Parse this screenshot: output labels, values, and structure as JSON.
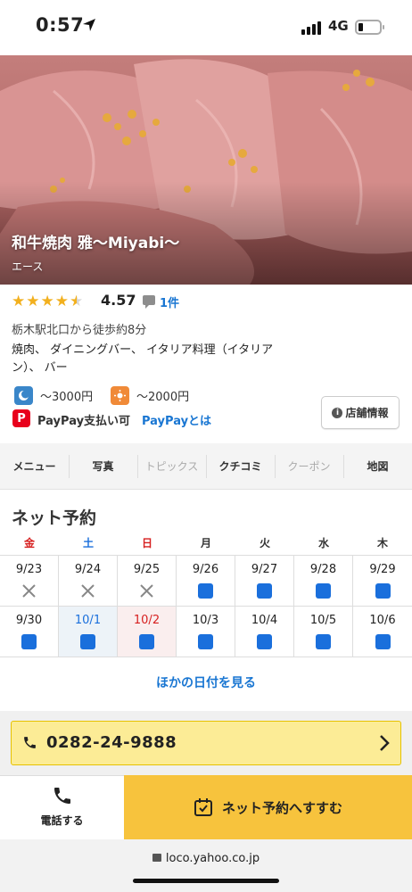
{
  "status_bar": {
    "time": "0:57",
    "network": "4G"
  },
  "hero": {
    "restaurant_name": "和牛焼肉 雅〜Miyabi〜",
    "area_label": "エース"
  },
  "rating": {
    "stars": 4.5,
    "score": "4.57",
    "review_count": "1件"
  },
  "access": "栃木駅北口から徒歩約8分",
  "genres": "焼肉、 ダイニングバー、 イタリア料理（イタリアン）、 バー",
  "prices": [
    {
      "icon": "moon-icon",
      "label": "〜3000円"
    },
    {
      "icon": "sun-icon",
      "label": "〜2000円"
    }
  ],
  "paypay": {
    "badge": "P",
    "available": "PayPay支払い可",
    "link": "PayPayとは"
  },
  "store_info_button": "店舗情報",
  "tabs": [
    {
      "label": "メニュー",
      "enabled": true
    },
    {
      "label": "写真",
      "enabled": true
    },
    {
      "label": "トピックス",
      "enabled": false
    },
    {
      "label": "クチコミ",
      "enabled": true
    },
    {
      "label": "クーポン",
      "enabled": false
    },
    {
      "label": "地図",
      "enabled": true
    }
  ],
  "booking": {
    "title": "ネット予約",
    "weekdays": [
      {
        "label": "金",
        "color": "#d61f1f"
      },
      {
        "label": "土",
        "color": "#1a6fdc"
      },
      {
        "label": "日",
        "color": "#d61f1f"
      },
      {
        "label": "月",
        "color": "#333333"
      },
      {
        "label": "火",
        "color": "#333333"
      },
      {
        "label": "水",
        "color": "#333333"
      },
      {
        "label": "木",
        "color": "#333333"
      }
    ],
    "weeks": [
      [
        {
          "date": "9/23",
          "status": "closed"
        },
        {
          "date": "9/24",
          "status": "closed"
        },
        {
          "date": "9/25",
          "status": "closed"
        },
        {
          "date": "9/26",
          "status": "available"
        },
        {
          "date": "9/27",
          "status": "available"
        },
        {
          "date": "9/28",
          "status": "available"
        },
        {
          "date": "9/29",
          "status": "available"
        }
      ],
      [
        {
          "date": "9/30",
          "status": "available"
        },
        {
          "date": "10/1",
          "status": "available",
          "highlight": "today",
          "date_color": "#1a6fdc"
        },
        {
          "date": "10/2",
          "status": "available",
          "highlight": "sunday",
          "date_color": "#d61f1f"
        },
        {
          "date": "10/3",
          "status": "available"
        },
        {
          "date": "10/4",
          "status": "available"
        },
        {
          "date": "10/5",
          "status": "available"
        },
        {
          "date": "10/6",
          "status": "available"
        }
      ]
    ],
    "more_dates": "ほかの日付を見る"
  },
  "phone": {
    "number": "0282-24-9888"
  },
  "actions": {
    "call_label": "電話する",
    "book_label": "ネット予約へすすむ"
  },
  "browser": {
    "url": "loco.yahoo.co.jp"
  },
  "colors": {
    "accent_blue": "#1976d2",
    "cta_yellow": "#f7c33d",
    "phone_bar": "#fcec96",
    "available": "#1a6fdc"
  }
}
